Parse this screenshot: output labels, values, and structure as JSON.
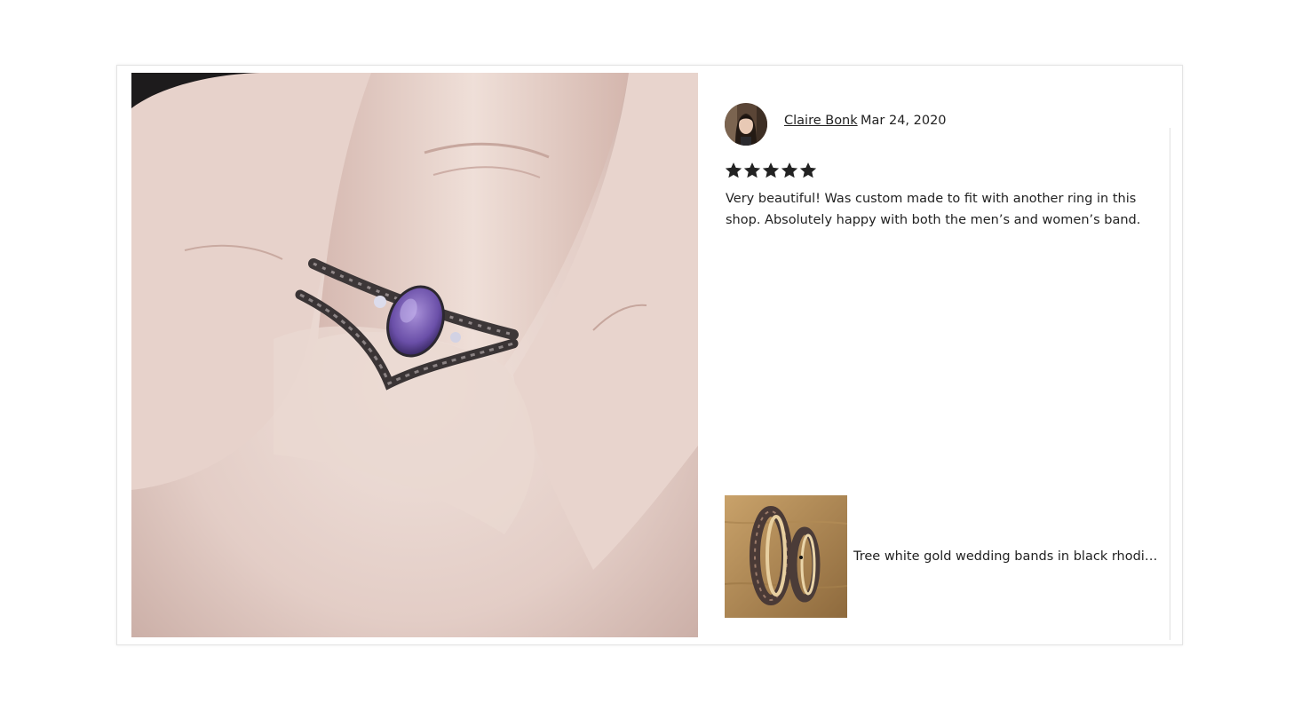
{
  "review": {
    "reviewer_name": "Claire Bonk",
    "date": "Mar 24, 2020",
    "rating": 5,
    "rating_max": 5,
    "star_color": "#222222",
    "text": "Very beautiful! Was custom made to fit with another ring in this shop. Absolutely happy with both the men’s and women’s band."
  },
  "listing": {
    "title": "Tree white gold wedding bands in black rhodium ..."
  },
  "icons": {
    "star": "star-icon",
    "photo": "review-photo",
    "avatar": "reviewer-avatar"
  }
}
